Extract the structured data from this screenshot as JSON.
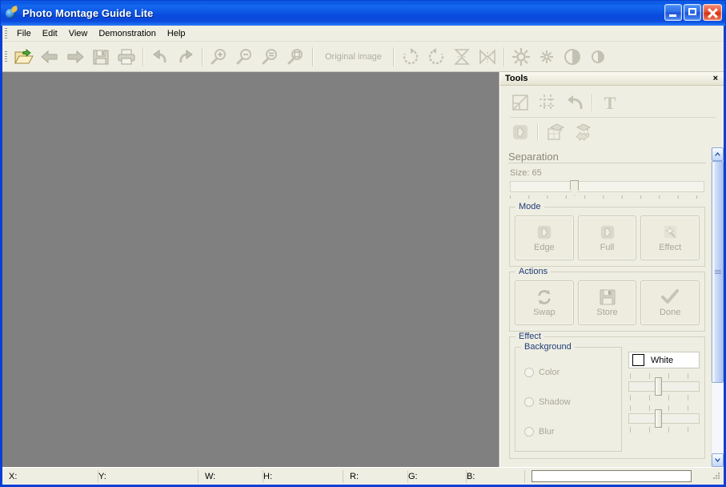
{
  "window": {
    "title": "Photo Montage Guide Lite",
    "icon": "app-globe-icon",
    "minimize_label": "Minimize",
    "maximize_label": "Maximize",
    "close_label": "Close"
  },
  "menubar": {
    "items": [
      {
        "label": "File"
      },
      {
        "label": "Edit"
      },
      {
        "label": "View"
      },
      {
        "label": "Demonstration"
      },
      {
        "label": "Help"
      }
    ]
  },
  "toolbar": {
    "buttons": [
      {
        "name": "open-file-button",
        "icon": "open-folder-icon",
        "enabled": true
      },
      {
        "name": "back-button",
        "icon": "arrow-left-icon",
        "enabled": false
      },
      {
        "name": "forward-button",
        "icon": "arrow-right-icon",
        "enabled": false
      },
      {
        "name": "save-button",
        "icon": "floppy-disk-icon",
        "enabled": false
      },
      {
        "name": "print-button",
        "icon": "printer-icon",
        "enabled": false
      },
      {
        "name": "undo-button",
        "icon": "undo-arrow-icon",
        "enabled": false
      },
      {
        "name": "redo-button",
        "icon": "redo-arrow-icon",
        "enabled": false
      },
      {
        "name": "zoom-in-button",
        "icon": "magnifier-plus-icon",
        "enabled": false
      },
      {
        "name": "zoom-out-button",
        "icon": "magnifier-minus-icon",
        "enabled": false
      },
      {
        "name": "zoom-actual-button",
        "icon": "magnifier-equals-icon",
        "enabled": false
      },
      {
        "name": "zoom-fit-button",
        "icon": "magnifier-fit-icon",
        "enabled": false
      }
    ],
    "original_image_label": "Original image",
    "right_buttons": [
      {
        "name": "rotate-cw-button",
        "icon": "rotate-clockwise-icon"
      },
      {
        "name": "rotate-ccw-button",
        "icon": "rotate-counterclockwise-icon"
      },
      {
        "name": "flip-vertical-button",
        "icon": "flip-vertical-icon"
      },
      {
        "name": "flip-horizontal-button",
        "icon": "flip-horizontal-icon"
      },
      {
        "name": "brightness-button",
        "icon": "sun-large-icon"
      },
      {
        "name": "gamma-button",
        "icon": "sun-small-icon"
      },
      {
        "name": "contrast-button",
        "icon": "contrast-circle-icon"
      },
      {
        "name": "saturation-button",
        "icon": "contrast-small-icon"
      }
    ]
  },
  "tools": {
    "title": "Tools",
    "close_label": "×",
    "row1": [
      {
        "name": "crop-tool-button",
        "icon": "crop-icon"
      },
      {
        "name": "grid-tool-button",
        "icon": "grid-icon"
      },
      {
        "name": "revert-tool-button",
        "icon": "undo-curve-icon"
      },
      {
        "name": "text-tool-button",
        "icon": "text-t-icon"
      }
    ],
    "row2": [
      {
        "name": "separation-tool-button",
        "icon": "puzzle-piece-icon"
      },
      {
        "name": "guide-square-button",
        "icon": "graduation-cap-square-icon"
      },
      {
        "name": "guide-burst-button",
        "icon": "graduation-cap-burst-icon"
      }
    ],
    "separation": {
      "heading": "Separation",
      "size_label": "Size: 65",
      "size_value": 65,
      "slider_percent": 33
    },
    "mode": {
      "heading": "Mode",
      "buttons": [
        {
          "label": "Edge",
          "icon": "puzzle-piece-icon"
        },
        {
          "label": "Full",
          "icon": "puzzle-piece-icon"
        },
        {
          "label": "Effect",
          "icon": "magic-wand-icon"
        }
      ]
    },
    "actions": {
      "heading": "Actions",
      "buttons": [
        {
          "label": "Swap",
          "icon": "swap-arrows-icon"
        },
        {
          "label": "Store",
          "icon": "floppy-disk-icon"
        },
        {
          "label": "Done",
          "icon": "checkmark-icon"
        }
      ]
    },
    "effect": {
      "heading": "Effect",
      "background": {
        "heading": "Background",
        "options": [
          {
            "label": "Color",
            "selected": false
          },
          {
            "label": "Shadow",
            "selected": false
          },
          {
            "label": "Blur",
            "selected": false
          }
        ],
        "color_value": "White",
        "color_hex": "#FFFFFF",
        "shadow_slider_percent": 42,
        "blur_slider_percent": 42
      }
    }
  },
  "statusbar": {
    "fields": [
      {
        "key": "X:",
        "value": ""
      },
      {
        "key": "Y:",
        "value": ""
      },
      {
        "key": "W:",
        "value": ""
      },
      {
        "key": "H:",
        "value": ""
      },
      {
        "key": "R:",
        "value": ""
      },
      {
        "key": "G:",
        "value": ""
      },
      {
        "key": "B:",
        "value": ""
      }
    ],
    "message": ""
  },
  "canvas": {
    "background_hex": "#808080",
    "content": ""
  }
}
